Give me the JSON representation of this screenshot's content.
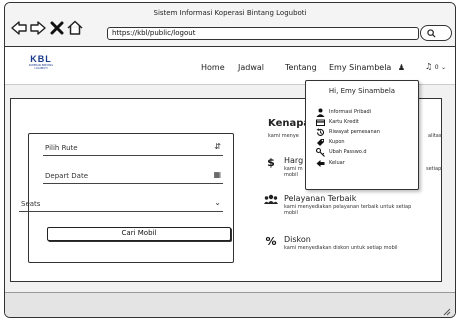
{
  "window": {
    "title": "Sistem Informasi Koperasi Bintang Loguboti"
  },
  "browser": {
    "url": "https://kbl/public/logout"
  },
  "logo": {
    "main": "KBL",
    "sub": "KOPERASI BINTANG LOGUBOTI"
  },
  "navbar": {
    "links": [
      "Home",
      "Jadwal",
      "Tentang"
    ],
    "user_name": "Emy Sinambela",
    "notification_count": "0"
  },
  "form": {
    "route_placeholder": "Pilih Rute",
    "date_placeholder": "Depart Date",
    "seats_placeholder": "Seats",
    "submit_label": "Cari Mobil"
  },
  "features": {
    "title": "Kenapa",
    "subtitle_left": "kami menye",
    "subtitle_right": "alitas",
    "items": [
      {
        "icon": "dollar-icon",
        "title": "Harg",
        "desc": "kami m",
        "desc_right": "setiap",
        "desc2": "mobil"
      },
      {
        "icon": "group-icon",
        "title": "Pelayanan Terbaik",
        "desc": "kami menyediakan pelayanan terbaik untuk setiap",
        "desc2": "mobil"
      },
      {
        "icon": "percent-icon",
        "title": "Diskon",
        "desc": "kami menyediakan diskon untuk setiap mobil"
      }
    ]
  },
  "dropdown": {
    "greeting": "Hi, Emy Sinambela",
    "items": [
      {
        "label": "Informasi Pribadi",
        "icon": "user-icon"
      },
      {
        "label": "Kartu Kredit",
        "icon": "credit-card-icon"
      },
      {
        "label": "Riwayat pemesanan",
        "icon": "history-icon"
      },
      {
        "label": "Kupon",
        "icon": "tag-icon"
      },
      {
        "label": "Ubah Passwo.d",
        "icon": "key-icon"
      },
      {
        "label": "Keluar",
        "icon": "sign-out-icon"
      }
    ]
  }
}
